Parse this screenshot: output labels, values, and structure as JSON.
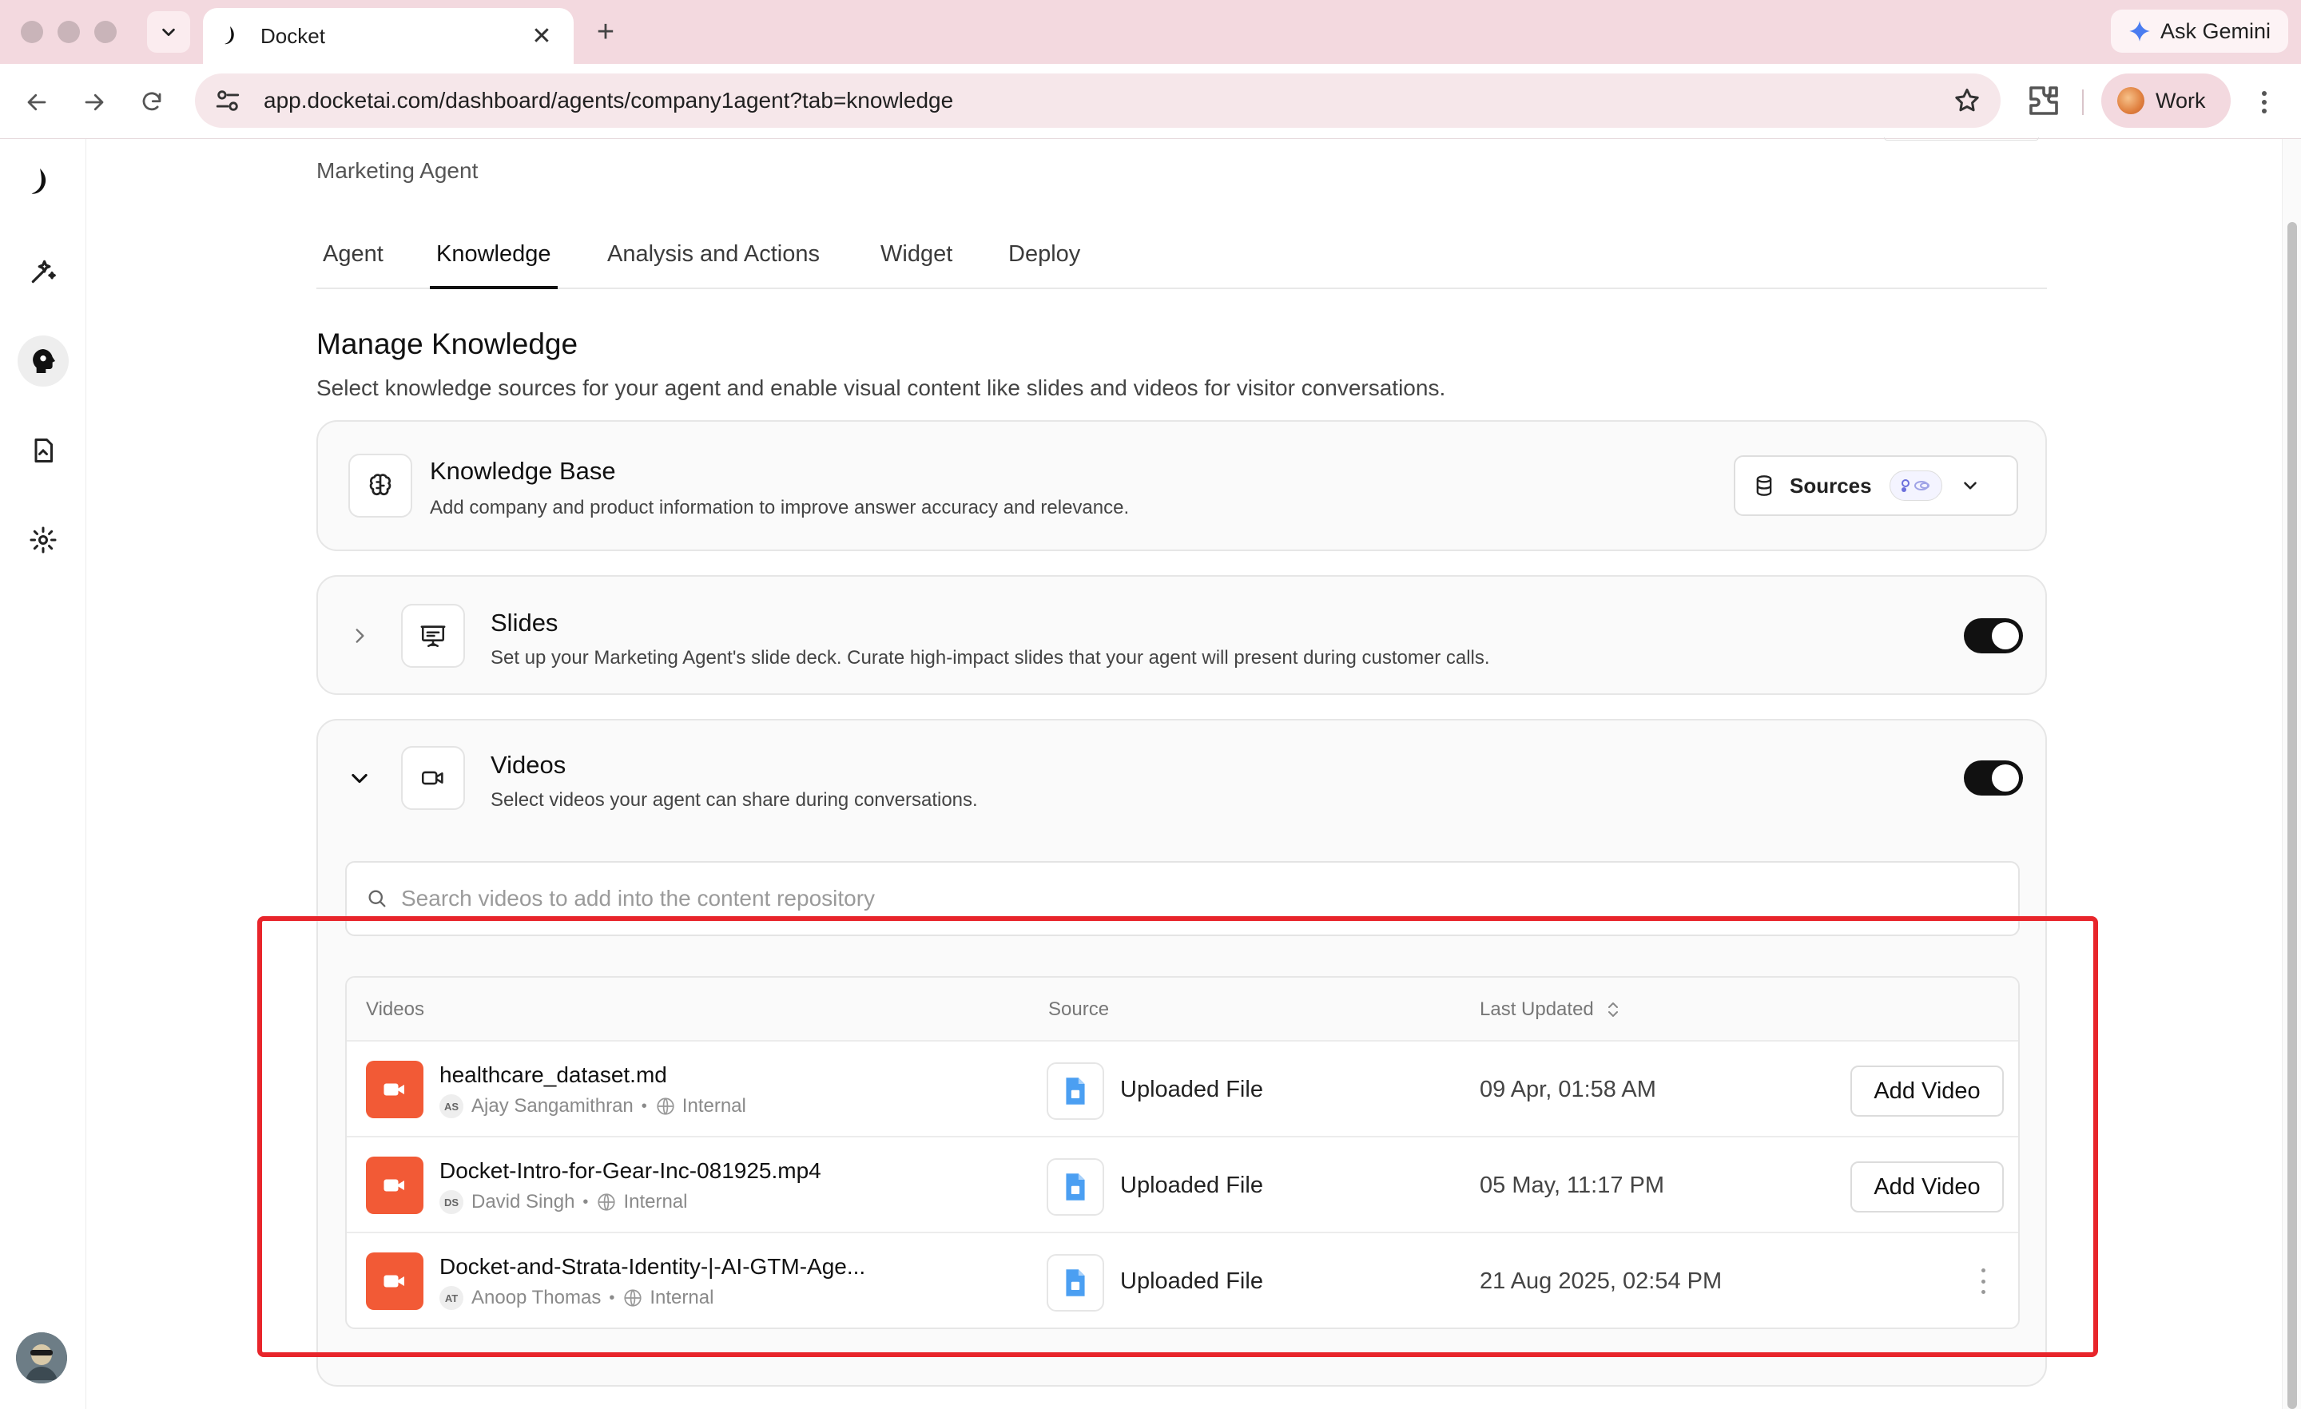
{
  "browser": {
    "tab_title": "Docket",
    "url": "app.docketai.com/dashboard/agents/company1agent?tab=knowledge",
    "gemini_label": "Ask Gemini",
    "profile_label": "Work"
  },
  "page": {
    "breadcrumb": "Marketing Agent",
    "tabs": [
      {
        "label": "Agent"
      },
      {
        "label": "Knowledge"
      },
      {
        "label": "Analysis and Actions"
      },
      {
        "label": "Widget"
      },
      {
        "label": "Deploy"
      }
    ],
    "active_tab": "Knowledge",
    "section_title": "Manage Knowledge",
    "section_desc": "Select knowledge sources for your agent and enable visual content like slides and videos for visitor conversations."
  },
  "knowledge_base": {
    "title": "Knowledge Base",
    "desc": "Add company and product information to improve answer accuracy and relevance.",
    "sources_label": "Sources"
  },
  "slides": {
    "title": "Slides",
    "desc": "Set up your Marketing Agent's slide deck. Curate high-impact slides that your agent will present during customer calls.",
    "enabled": true
  },
  "videos": {
    "title": "Videos",
    "desc": "Select videos your agent can share during conversations.",
    "enabled": true,
    "search_placeholder": "Search videos to add into the content repository",
    "columns": {
      "videos": "Videos",
      "source": "Source",
      "last_updated": "Last Updated"
    },
    "rows": [
      {
        "name": "healthcare_dataset.md",
        "initials": "AS",
        "owner": "Ajay Sangamithran",
        "visibility": "Internal",
        "source": "Uploaded File",
        "updated": "09 Apr, 01:58 AM",
        "action": "Add Video"
      },
      {
        "name": "Docket-Intro-for-Gear-Inc-081925.mp4",
        "initials": "DS",
        "owner": "David Singh",
        "visibility": "Internal",
        "source": "Uploaded File",
        "updated": "05 May, 11:17 PM",
        "action": "Add Video"
      },
      {
        "name": "Docket-and-Strata-Identity-|-AI-GTM-Age...",
        "initials": "AT",
        "owner": "Anoop Thomas",
        "visibility": "Internal",
        "source": "Uploaded File",
        "updated": "21 Aug 2025, 02:54 PM",
        "action": ""
      }
    ]
  },
  "colors": {
    "video_icon": "#f25a36",
    "highlight": "#e8252b",
    "toggle_on": "#111111"
  }
}
